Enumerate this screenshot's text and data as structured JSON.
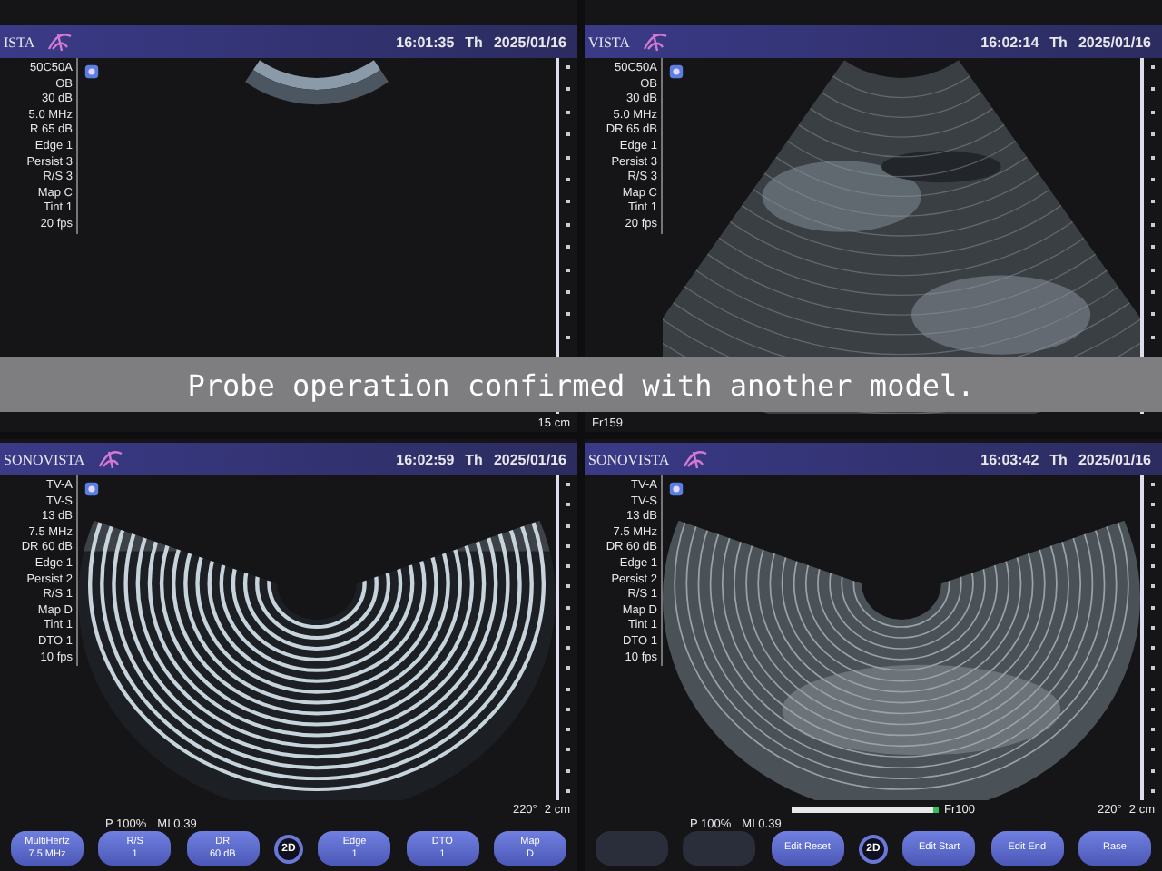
{
  "caption": "Probe operation confirmed with another model.",
  "panels": [
    {
      "logo": "ISTA",
      "time": "16:01:35",
      "day": "Th",
      "date": "2025/01/16",
      "kind": "convex-idle",
      "params": [
        "50C50A",
        "OB",
        "30 dB",
        "5.0 MHz",
        "R 65 dB",
        "Edge 1",
        "Persist 3",
        "R/S 3",
        "Map C",
        "Tint 1",
        "20 fps"
      ],
      "footer": {
        "scale": "15 cm"
      }
    },
    {
      "logo": "VISTA",
      "time": "16:02:14",
      "day": "Th",
      "date": "2025/01/16",
      "kind": "convex",
      "params": [
        "50C50A",
        "OB",
        "30 dB",
        "5.0 MHz",
        "DR 65 dB",
        "Edge 1",
        "Persist 3",
        "R/S 3",
        "Map C",
        "Tint 1",
        "20 fps"
      ],
      "footer": {
        "frame": "Fr159"
      }
    },
    {
      "logo": "SONOVISTA",
      "time": "16:02:59",
      "day": "Th",
      "date": "2025/01/16",
      "kind": "radial-rings",
      "params": [
        "TV-A",
        "TV-S",
        "13 dB",
        "7.5 MHz",
        "DR 60 dB",
        "Edge 1",
        "Persist 2",
        "R/S 1",
        "Map D",
        "Tint 1",
        "DTO 1",
        "10 fps"
      ],
      "footer": {
        "angle": "220°",
        "scale": "2 cm"
      },
      "controls": {
        "power": "P 100%",
        "mi": "MI 0.39",
        "buttons": [
          {
            "kind": "labeled",
            "label": "MultiHertz",
            "value": "7.5 MHz"
          },
          {
            "kind": "labeled",
            "label": "R/S",
            "value": "1"
          },
          {
            "kind": "labeled",
            "label": "DR",
            "value": "60 dB"
          },
          {
            "kind": "mode",
            "label": "2D"
          },
          {
            "kind": "labeled",
            "label": "Edge",
            "value": "1"
          },
          {
            "kind": "labeled",
            "label": "DTO",
            "value": "1"
          },
          {
            "kind": "labeled",
            "label": "Map",
            "value": "D"
          }
        ]
      }
    },
    {
      "logo": "SONOVISTA",
      "time": "16:03:42",
      "day": "Th",
      "date": "2025/01/16",
      "kind": "radial",
      "params": [
        "TV-A",
        "TV-S",
        "13 dB",
        "7.5 MHz",
        "DR 60 dB",
        "Edge 1",
        "Persist 2",
        "R/S 1",
        "Map D",
        "Tint 1",
        "DTO 1",
        "10 fps"
      ],
      "footer": {
        "angle": "220°",
        "frame": "Fr100",
        "scale": "2 cm",
        "cine": {
          "level": 0.97
        }
      },
      "controls": {
        "power": "P 100%",
        "mi": "MI 0.39",
        "buttons": [
          {
            "kind": "blank"
          },
          {
            "kind": "blank"
          },
          {
            "kind": "single",
            "label": "Edit Reset"
          },
          {
            "kind": "mode",
            "label": "2D"
          },
          {
            "kind": "single",
            "label": "Edit Start"
          },
          {
            "kind": "single",
            "label": "Edit End"
          },
          {
            "kind": "single",
            "label": "Rase"
          }
        ]
      }
    }
  ]
}
